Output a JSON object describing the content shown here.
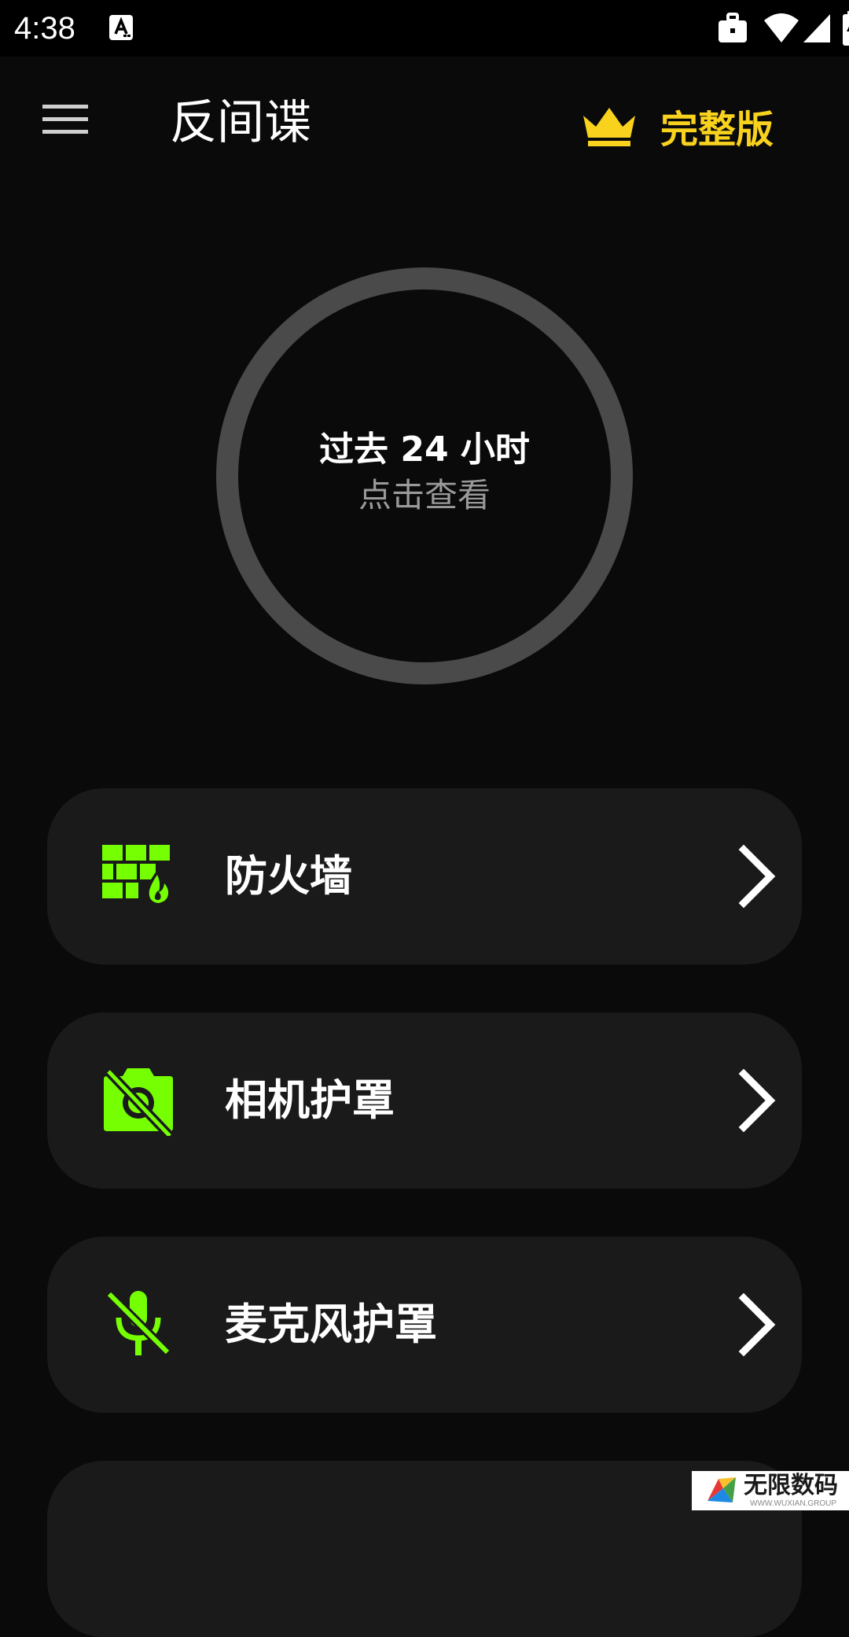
{
  "status_bar": {
    "time": "4:38",
    "icons": [
      "notification-a-icon",
      "briefcase-icon",
      "wifi-icon",
      "signal-icon",
      "battery-charging-icon"
    ]
  },
  "app_bar": {
    "title": "反间谍",
    "menu_icon": "menu-icon",
    "upgrade_label": "完整版",
    "upgrade_icon": "crown-icon",
    "accent_color": "#f9d21e"
  },
  "summary": {
    "title": "过去 24 小时",
    "subtitle": "点击查看"
  },
  "features": [
    {
      "label": "防火墙",
      "icon": "firewall-icon"
    },
    {
      "label": "相机护罩",
      "icon": "camera-off-icon"
    },
    {
      "label": "麦克风护罩",
      "icon": "mic-off-icon"
    }
  ],
  "colors": {
    "background": "#0a0a0a",
    "card": "#1a1a1a",
    "icon_green": "#76ff03",
    "ring": "#4a4a4a"
  },
  "watermark": {
    "text": "无限数码",
    "sub": "WWW.WUXIAN.GROUP"
  }
}
